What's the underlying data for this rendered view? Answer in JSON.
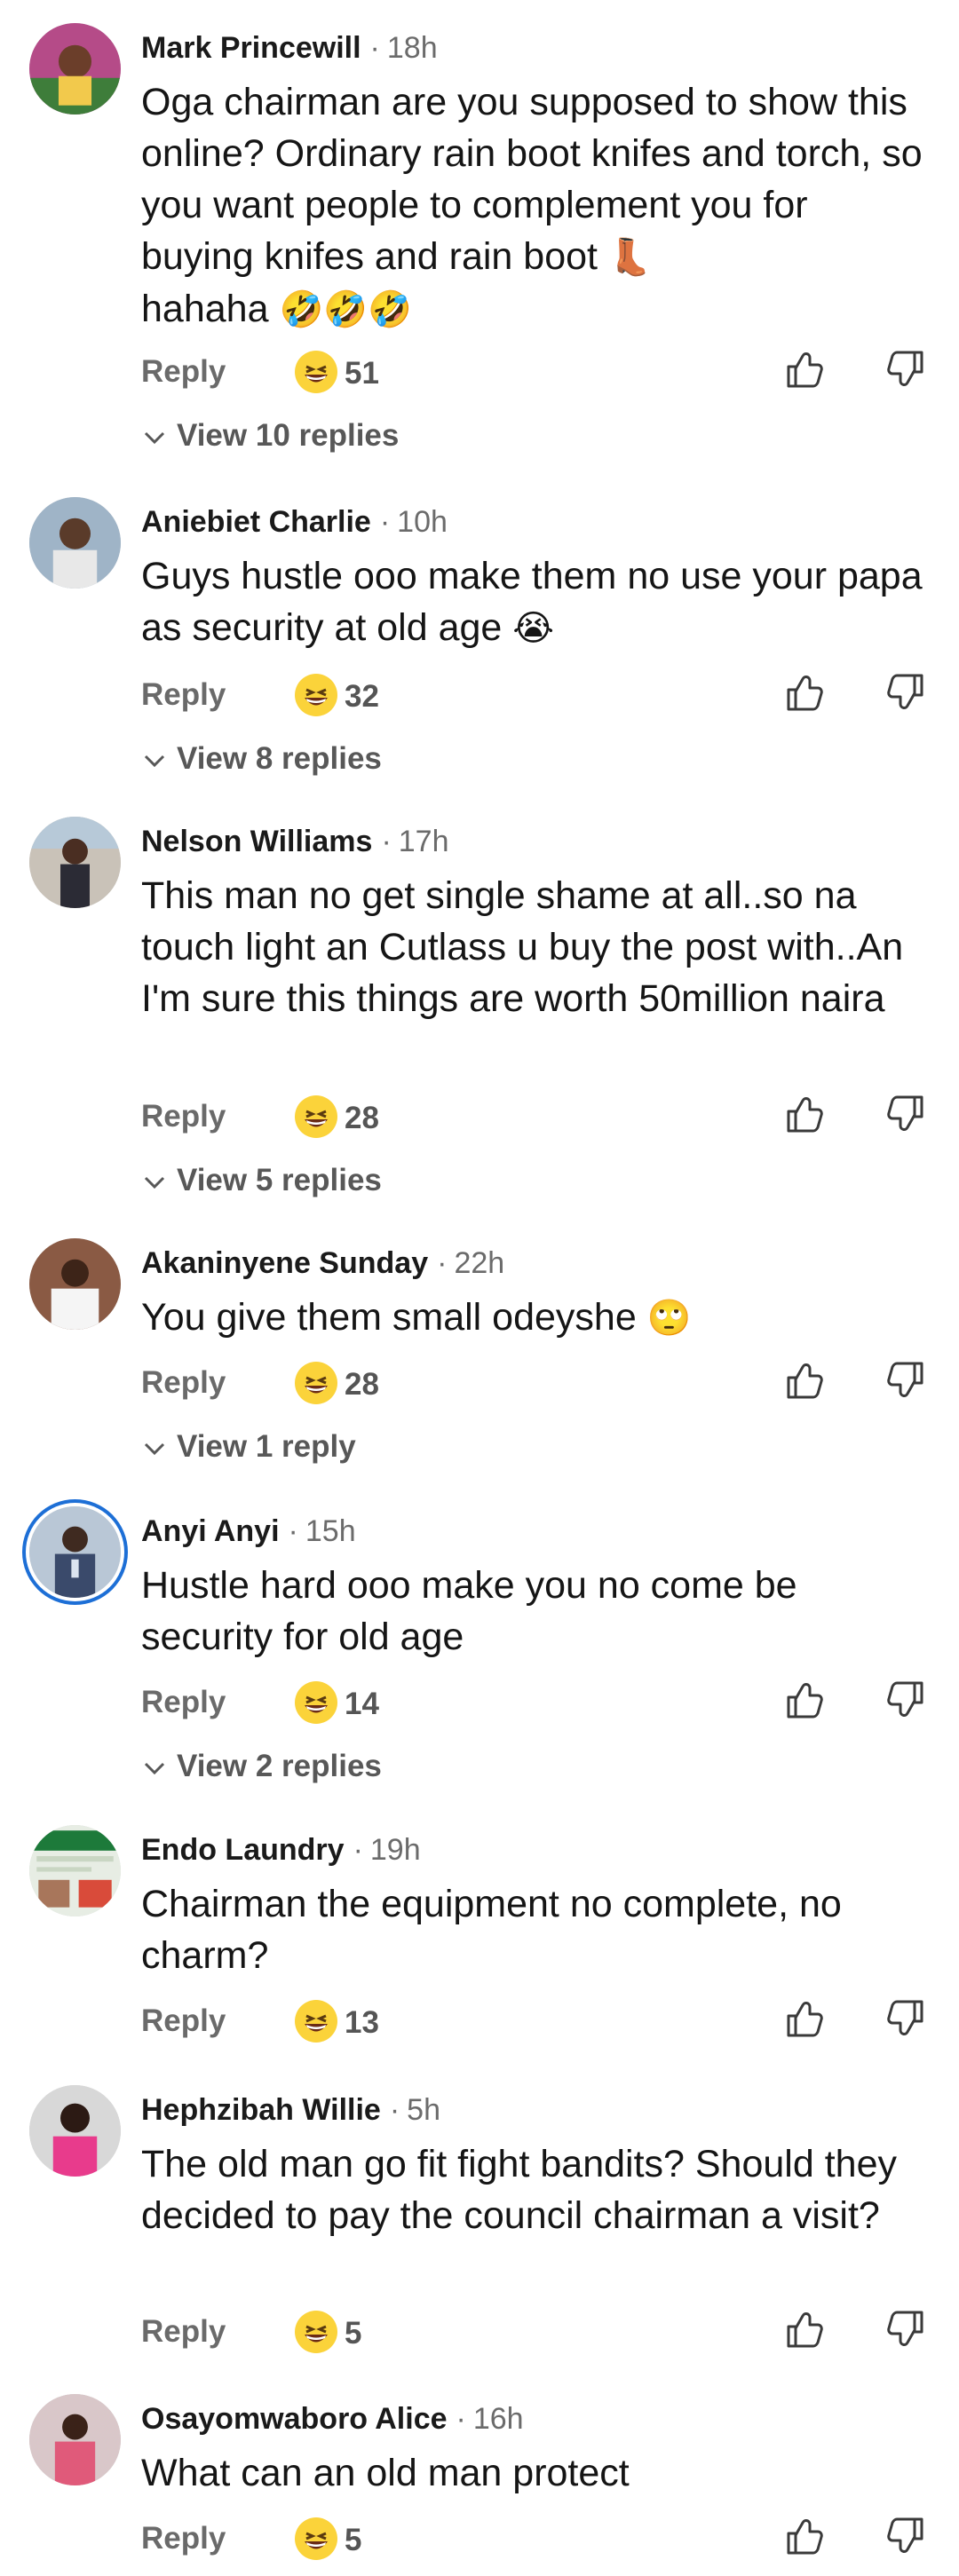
{
  "comments": [
    {
      "author": "Mark Princewill",
      "separator": "·",
      "time": "18h",
      "text": "Oga chairman are you supposed to show this online? Ordinary rain boot knifes and torch, so you want people to complement you for buying knifes and rain boot",
      "text_emoji": "👢",
      "text_tail": "hahaha",
      "tail_emoji": "🤣🤣🤣",
      "reply_label": "Reply",
      "reaction_emoji": "😝",
      "reaction_count": "51",
      "view_replies": "View 10 replies",
      "avatar_bg": "#b54b88",
      "avatar_fg": "#f2c94c"
    },
    {
      "author": "Aniebiet Charlie",
      "separator": "·",
      "time": "10h",
      "text": "Guys hustle ooo make them no use your papa as security at old age",
      "text_emoji": "😭",
      "reply_label": "Reply",
      "reaction_emoji": "😝",
      "reaction_count": "32",
      "view_replies": "View 8 replies",
      "avatar_bg": "#9fb4c7",
      "avatar_fg": "#e8e8e8"
    },
    {
      "author": "Nelson Williams",
      "separator": "·",
      "time": "17h",
      "text": "This man no get single shame at all..so na touch light an Cutlass u buy the post with..An I'm sure this things are worth 50million naira",
      "reply_label": "Reply",
      "reaction_emoji": "😝",
      "reaction_count": "28",
      "view_replies": "View 5 replies",
      "avatar_bg": "#c9c2b8",
      "avatar_fg": "#2b2b35"
    },
    {
      "author": "Akaninyene Sunday",
      "separator": "·",
      "time": "22h",
      "text": "You give them small odeyshe",
      "text_emoji": "🙄",
      "reply_label": "Reply",
      "reaction_emoji": "😝",
      "reaction_count": "28",
      "view_replies": "View 1 reply",
      "avatar_bg": "#8a5a44",
      "avatar_fg": "#f5f5f5"
    },
    {
      "author": "Anyi Anyi",
      "separator": "·",
      "time": "15h",
      "text": "Hustle hard ooo make you no come be security for old age",
      "reply_label": "Reply",
      "reaction_emoji": "😝",
      "reaction_count": "14",
      "view_replies": "View 2 replies",
      "avatar_bg": "#b9c7d6",
      "avatar_fg": "#3a4a6b"
    },
    {
      "author": "Endo Laundry",
      "separator": "·",
      "time": "19h",
      "text": "Chairman the equipment no complete, no charm?",
      "reply_label": "Reply",
      "reaction_emoji": "😝",
      "reaction_count": "13",
      "avatar_bg": "#e7ede4",
      "avatar_fg": "#1d7a3a"
    },
    {
      "author": "Hephzibah Willie",
      "separator": "·",
      "time": "5h",
      "text": "The old man go fit fight bandits? Should they decided to pay the council chairman a visit?",
      "reply_label": "Reply",
      "reaction_emoji": "😝",
      "reaction_count": "5",
      "avatar_bg": "#d8d8d8",
      "avatar_fg": "#e83b8c"
    },
    {
      "author": "Osayomwaboro Alice",
      "separator": "·",
      "time": "16h",
      "text": "What can an old man protect",
      "reply_label": "Reply",
      "reaction_emoji": "😝",
      "reaction_count": "5",
      "avatar_bg": "#d9c7c9",
      "avatar_fg": "#e05a7a"
    }
  ],
  "colors": {
    "text": "#151515",
    "muted": "#6b6b6b",
    "reaction": "#fbd33a",
    "ring": "#1d6fd6"
  },
  "icons": {
    "like": "thumbs-up-icon",
    "dislike": "thumbs-down-icon",
    "expand": "chevron-down-icon"
  }
}
